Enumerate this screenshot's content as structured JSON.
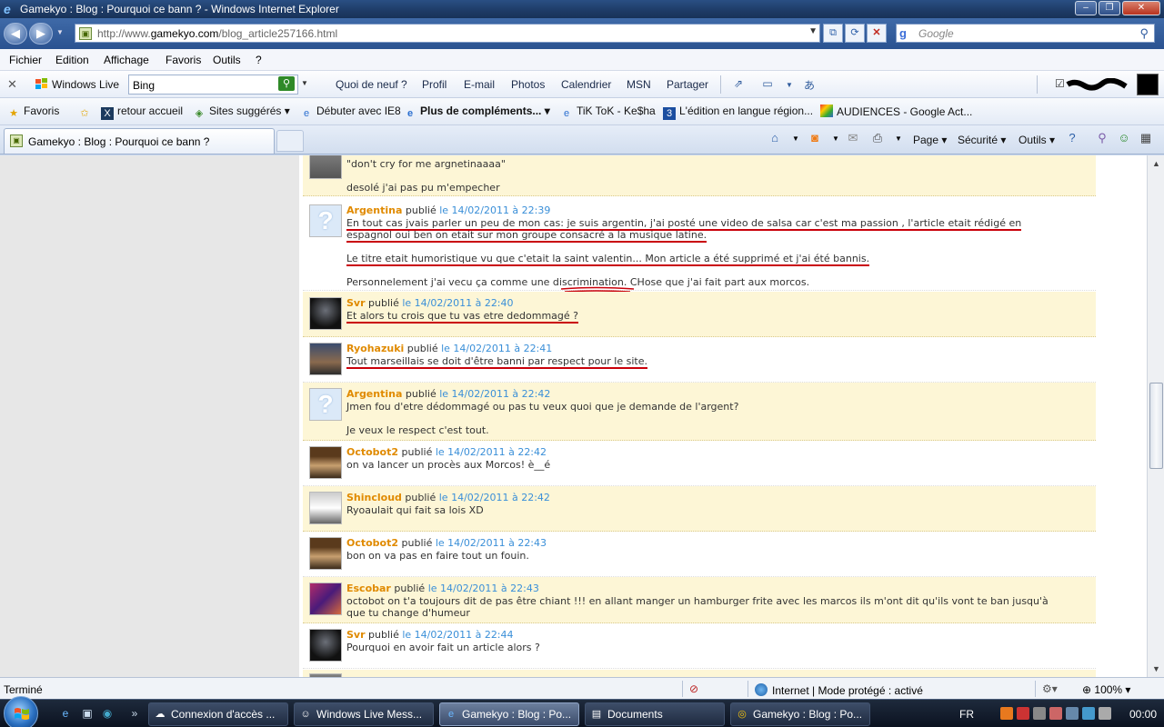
{
  "window": {
    "title": "Gamekyo : Blog : Pourquoi ce bann ? - Windows Internet Explorer"
  },
  "address": {
    "url_prefix": "http://www.",
    "url_domain": "gamekyo.com",
    "url_path": "/blog_article257166.html",
    "search_placeholder": "Google"
  },
  "menu": [
    "Fichier",
    "Edition",
    "Affichage",
    "Favoris",
    "Outils",
    "?"
  ],
  "wl_toolbar": {
    "brand": "Windows Live",
    "search_value": "Bing",
    "links": [
      "Quoi de neuf ?",
      "Profil",
      "E-mail",
      "Photos",
      "Calendrier",
      "MSN",
      "Partager"
    ]
  },
  "favorites": {
    "label": "Favoris",
    "items": [
      "retour accueil",
      "Sites suggérés",
      "Débuter avec IE8",
      "Plus de compléments...",
      "TiK ToK - Ke$ha",
      "L'édition en langue région...",
      "AUDIENCES - Google Act..."
    ]
  },
  "tab": {
    "label": "Gamekyo : Blog : Pourquoi ce bann ?"
  },
  "command_bar": [
    "Page",
    "Sécurité",
    "Outils"
  ],
  "comments": [
    {
      "lines": [
        "\"don't cry for me argnetinaaaa\"",
        "desolé j'ai pas pu m'empecher"
      ]
    },
    {
      "author": "Argentina",
      "published": "publié",
      "date": "le 14/02/2011 à 22:39",
      "lines": [
        "En tout cas jvais parler un peu de mon cas: je suis argentin, j'ai posté une video de salsa car c'est ma passion , l'article etait rédigé en",
        "espagnol oui ben on etait sur mon groupe consacré a la musique latine.",
        "Le titre etait humoristique vu que c'etait la saint valentin... Mon article a été supprimé et j'ai été bannis.",
        "Personnelement j'ai vecu ça comme une discrimination. CHose que j'ai fait part aux morcos."
      ]
    },
    {
      "author": "Svr",
      "published": "publié",
      "date": "le 14/02/2011 à 22:40",
      "lines": [
        "Et alors tu crois que tu vas etre dedommagé ?"
      ]
    },
    {
      "author": "Ryohazuki",
      "published": "publié",
      "date": "le 14/02/2011 à 22:41",
      "lines": [
        "Tout marseillais se doit d'être banni par respect pour le site."
      ]
    },
    {
      "author": "Argentina",
      "published": "publié",
      "date": "le 14/02/2011 à 22:42",
      "lines": [
        "Jmen fou d'etre dédommagé ou pas tu veux quoi que je demande de l'argent?",
        "Je veux le respect c'est tout."
      ]
    },
    {
      "author": "Octobot2",
      "published": "publié",
      "date": "le 14/02/2011 à 22:42",
      "lines": [
        "on va lancer un procès aux Morcos! è__é"
      ]
    },
    {
      "author": "Shincloud",
      "published": "publié",
      "date": "le 14/02/2011 à 22:42",
      "lines": [
        "Ryoaulait qui fait sa lois XD"
      ]
    },
    {
      "author": "Octobot2",
      "published": "publié",
      "date": "le 14/02/2011 à 22:43",
      "lines": [
        "bon on va pas en faire tout un fouin."
      ]
    },
    {
      "author": "Escobar",
      "published": "publié",
      "date": "le 14/02/2011 à 22:43",
      "lines": [
        "octobot on t'a toujours dit de pas être chiant !!! en allant manger un hamburger frite avec les marcos ils m'ont dit qu'ils vont te ban jusqu'à",
        "que tu change d'humeur"
      ]
    },
    {
      "author": "Svr",
      "published": "publié",
      "date": "le 14/02/2011 à 22:44",
      "lines": [
        "Pourquoi en avoir fait un article alors ?"
      ]
    }
  ],
  "status": {
    "text": "Terminé",
    "zone": "Internet | Mode protégé : activé",
    "zoom": "100%"
  },
  "taskbar": {
    "tasks": [
      "Connexion d'accès ...",
      "Windows Live Mess...",
      "Gamekyo : Blog : Po...",
      "Documents",
      "Gamekyo : Blog : Po..."
    ],
    "lang": "FR",
    "time": "00:00"
  }
}
